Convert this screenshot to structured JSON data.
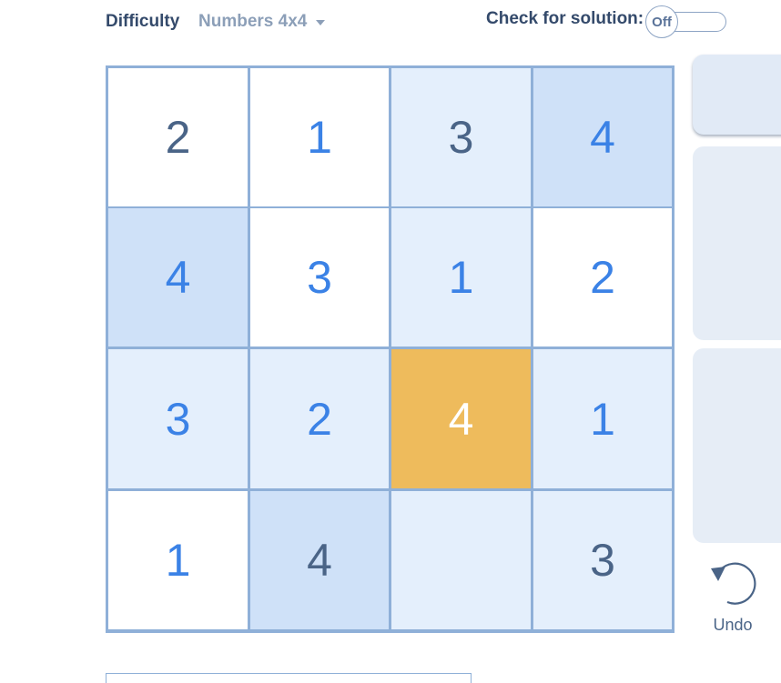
{
  "header": {
    "difficulty_label": "Difficulty",
    "difficulty_value": "Numbers 4x4",
    "check_label": "Check for solution:",
    "toggle_state": "Off"
  },
  "board": {
    "size": 4,
    "cells": [
      [
        {
          "value": "2",
          "kind": "given",
          "shade": "white"
        },
        {
          "value": "1",
          "kind": "user",
          "shade": "white"
        },
        {
          "value": "3",
          "kind": "given",
          "shade": "light"
        },
        {
          "value": "4",
          "kind": "user",
          "shade": "mid"
        }
      ],
      [
        {
          "value": "4",
          "kind": "user",
          "shade": "mid"
        },
        {
          "value": "3",
          "kind": "user",
          "shade": "white"
        },
        {
          "value": "1",
          "kind": "user",
          "shade": "light"
        },
        {
          "value": "2",
          "kind": "user",
          "shade": "white"
        }
      ],
      [
        {
          "value": "3",
          "kind": "user",
          "shade": "light"
        },
        {
          "value": "2",
          "kind": "user",
          "shade": "light"
        },
        {
          "value": "4",
          "kind": "selected",
          "shade": "selected"
        },
        {
          "value": "1",
          "kind": "user",
          "shade": "light"
        }
      ],
      [
        {
          "value": "1",
          "kind": "user",
          "shade": "white"
        },
        {
          "value": "4",
          "kind": "given",
          "shade": "mid"
        },
        {
          "value": "",
          "kind": "user",
          "shade": "light"
        },
        {
          "value": "3",
          "kind": "given",
          "shade": "light"
        }
      ]
    ]
  },
  "controls": {
    "undo_label": "Undo",
    "undo_icon": "undo-icon"
  },
  "colors": {
    "selected_cell": "#eebb5c",
    "user_digit": "#3b82e6",
    "given_digit": "#4a6487",
    "grid_line": "#8fb0d8"
  }
}
